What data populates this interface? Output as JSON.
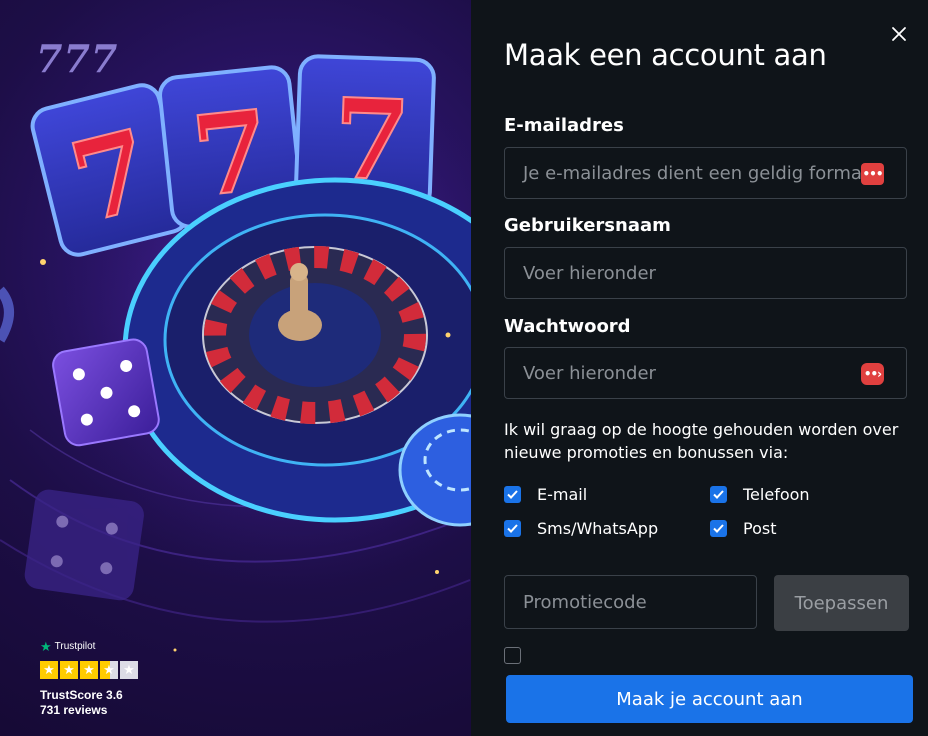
{
  "hero": {
    "logo": "777",
    "trustpilot": {
      "brand": "Trustpilot",
      "rating_stars": 3.5,
      "score_text": "TrustScore 3.6",
      "reviews_text": "731 reviews",
      "star_color": "#ffcc00",
      "brand_color": "#00b67a"
    },
    "art_icons": [
      "slot-reels-777-icon",
      "roulette-wheel-icon",
      "dice-icon",
      "casino-chip-icon"
    ]
  },
  "form": {
    "title": "Maak een account aan",
    "email": {
      "label": "E-mailadres",
      "placeholder": "Je e-mailadres dient een geldig formaat te hebben"
    },
    "username": {
      "label": "Gebruikersnaam",
      "placeholder": "Voer hieronder"
    },
    "password": {
      "label": "Wachtwoord",
      "placeholder": "Voer hieronder"
    },
    "consent_text": "Ik wil graag op de hoogte gehouden worden over nieuwe promoties en bonussen via:",
    "channels": [
      {
        "label": "E-mail",
        "checked": true
      },
      {
        "label": "Telefoon",
        "checked": true
      },
      {
        "label": "Sms/WhatsApp",
        "checked": true
      },
      {
        "label": "Post",
        "checked": true
      }
    ],
    "promo": {
      "placeholder": "Promotiecode",
      "apply_label": "Toepassen"
    },
    "submit_label": "Maak je account aan",
    "accent_color": "#1a73e8",
    "badge_color": "#e0403f"
  }
}
